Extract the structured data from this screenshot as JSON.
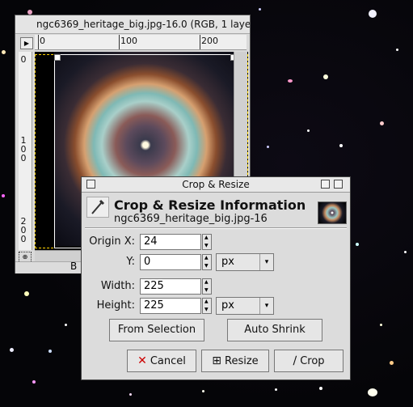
{
  "image_window": {
    "title": "ngc6369_heritage_big.jpg-16.0 (RGB, 1 laye",
    "ruler_top_labels": [
      "0",
      "100",
      "200"
    ],
    "ruler_left_labels": [
      "0",
      "1\n0\n0",
      "2\n0\n0"
    ],
    "status_text": "B"
  },
  "dialog": {
    "title": "Crop & Resize",
    "header_title": "Crop & Resize Information",
    "header_subtitle": "ngc6369_heritage_big.jpg-16",
    "origin_x_label": "Origin X:",
    "origin_x_value": "24",
    "origin_y_label": "Y:",
    "origin_y_value": "0",
    "origin_unit": "px",
    "width_label": "Width:",
    "width_value": "225",
    "height_label": "Height:",
    "height_value": "225",
    "size_unit": "px",
    "from_selection_label": "From Selection",
    "auto_shrink_label": "Auto Shrink",
    "cancel_label": "Cancel",
    "resize_label": "Resize",
    "crop_label": "Crop"
  }
}
